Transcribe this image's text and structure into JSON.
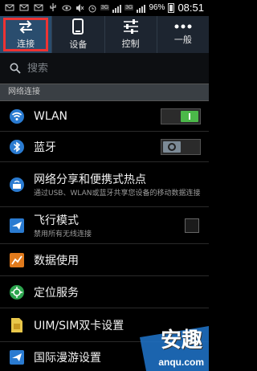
{
  "status_bar": {
    "network_3g_a": "3G",
    "network_3g_b": "3G",
    "battery": "96%",
    "time": "08:51"
  },
  "tabs": [
    {
      "label": "连接",
      "icon": "swap-arrows-icon",
      "active": true
    },
    {
      "label": "设备",
      "icon": "phone-icon",
      "active": false
    },
    {
      "label": "控制",
      "icon": "sliders-icon",
      "active": false
    },
    {
      "label": "一般",
      "icon": "more-dots-icon",
      "active": false
    }
  ],
  "search": {
    "placeholder": "搜索"
  },
  "section_header": "网络连接",
  "rows": [
    {
      "title": "WLAN",
      "icon": "wifi-icon",
      "control": "toggle",
      "state": "on"
    },
    {
      "title": "蓝牙",
      "icon": "bluetooth-icon",
      "control": "toggle",
      "state": "off"
    },
    {
      "title": "网络分享和便携式热点",
      "subtitle": "通过USB、WLAN或蓝牙共享您设备的移动数据连接",
      "icon": "hotspot-icon"
    },
    {
      "title": "飞行模式",
      "subtitle": "禁用所有无线连接",
      "icon": "airplane-icon",
      "control": "checkbox",
      "checked": false
    },
    {
      "title": "数据使用",
      "icon": "data-usage-icon"
    },
    {
      "title": "定位服务",
      "icon": "location-icon"
    },
    {
      "title": "UIM/SIM双卡设置",
      "icon": "sim-card-icon"
    },
    {
      "title": "国际漫游设置",
      "icon": "roaming-icon"
    }
  ],
  "watermark": {
    "text_cn": "安趣",
    "text_en": "anqu.com"
  }
}
